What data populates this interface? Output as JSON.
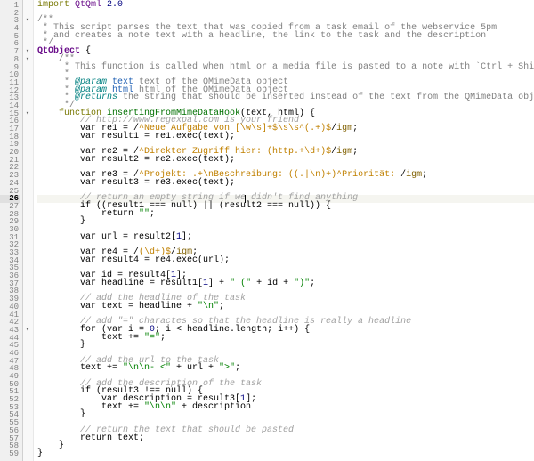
{
  "editor": {
    "current_line": 26,
    "fold_markers": [
      3,
      7,
      8,
      15,
      43
    ],
    "lines": [
      {
        "n": 1,
        "segs": [
          {
            "t": "import ",
            "c": "kw"
          },
          {
            "t": "QtQml ",
            "c": "type"
          },
          {
            "t": "2.0",
            "c": "num"
          }
        ]
      },
      {
        "n": 2,
        "segs": []
      },
      {
        "n": 3,
        "segs": [
          {
            "t": "/**",
            "c": "doc"
          }
        ]
      },
      {
        "n": 4,
        "segs": [
          {
            "t": " * This script parses the text that was copied from a task email of the webservice 5pm",
            "c": "doc"
          }
        ]
      },
      {
        "n": 5,
        "segs": [
          {
            "t": " * and creates a note text with a headline, the link to the task and the description",
            "c": "doc"
          }
        ]
      },
      {
        "n": 6,
        "segs": [
          {
            "t": " */",
            "c": "doc"
          }
        ]
      },
      {
        "n": 7,
        "segs": [
          {
            "t": "QtObject",
            "c": "obj"
          },
          {
            "t": " {",
            "c": "op"
          }
        ]
      },
      {
        "n": 8,
        "segs": [
          {
            "t": "    /**",
            "c": "doc"
          }
        ]
      },
      {
        "n": 9,
        "segs": [
          {
            "t": "     * This function is called when html or a media file is pasted to a note with `Ctrl + Shift + V`",
            "c": "doc"
          }
        ]
      },
      {
        "n": 10,
        "segs": [
          {
            "t": "     * ",
            "c": "doc"
          }
        ]
      },
      {
        "n": 11,
        "segs": [
          {
            "t": "     * ",
            "c": "doc"
          },
          {
            "t": "@param ",
            "c": "tag"
          },
          {
            "t": "text",
            "c": "pn"
          },
          {
            "t": " text of the QMimeData object",
            "c": "doc"
          }
        ]
      },
      {
        "n": 12,
        "segs": [
          {
            "t": "     * ",
            "c": "doc"
          },
          {
            "t": "@param ",
            "c": "tag"
          },
          {
            "t": "html",
            "c": "pn"
          },
          {
            "t": " html of the QMimeData object",
            "c": "doc"
          }
        ]
      },
      {
        "n": 13,
        "segs": [
          {
            "t": "     * ",
            "c": "doc"
          },
          {
            "t": "@returns",
            "c": "tag"
          },
          {
            "t": " the string that should be inserted instead of the text from the QMimeData object",
            "c": "doc"
          }
        ]
      },
      {
        "n": 14,
        "segs": [
          {
            "t": "     */",
            "c": "doc"
          }
        ]
      },
      {
        "n": 15,
        "segs": [
          {
            "t": "    function ",
            "c": "kw"
          },
          {
            "t": "insertingFromMimeDataHook",
            "c": "fn"
          },
          {
            "t": "(text, html) {",
            "c": "op"
          }
        ]
      },
      {
        "n": 16,
        "segs": [
          {
            "t": "        // http://www.regexpal.com is your friend",
            "c": "cmt"
          }
        ]
      },
      {
        "n": 17,
        "segs": [
          {
            "t": "        var re1 = /"
          },
          {
            "t": "^Neue Aufgabe von [\\w\\s]+$\\s\\s^(.+)$",
            "c": "regex"
          },
          {
            "t": "/"
          },
          {
            "t": "igm",
            "c": "flag"
          },
          {
            "t": ";"
          }
        ]
      },
      {
        "n": 18,
        "segs": [
          {
            "t": "        var result1 = re1.exec(text);"
          }
        ]
      },
      {
        "n": 19,
        "segs": []
      },
      {
        "n": 20,
        "segs": [
          {
            "t": "        var re2 = /"
          },
          {
            "t": "^Direkter Zugriff hier: (http.+\\d+)$",
            "c": "regex"
          },
          {
            "t": "/"
          },
          {
            "t": "igm",
            "c": "flag"
          },
          {
            "t": ";"
          }
        ]
      },
      {
        "n": 21,
        "segs": [
          {
            "t": "        var result2 = re2.exec(text);"
          }
        ]
      },
      {
        "n": 22,
        "segs": []
      },
      {
        "n": 23,
        "segs": [
          {
            "t": "        var re3 = /"
          },
          {
            "t": "^Projekt: .+\\nBeschreibung: ((.|\\n)+)^Priorität: ",
            "c": "regex"
          },
          {
            "t": "/"
          },
          {
            "t": "igm",
            "c": "flag"
          },
          {
            "t": ";"
          }
        ]
      },
      {
        "n": 24,
        "segs": [
          {
            "t": "        var result3 = re3.exec(text);"
          }
        ]
      },
      {
        "n": 25,
        "segs": []
      },
      {
        "n": 26,
        "hl": true,
        "segs": [
          {
            "t": "        // return an empty string if we",
            "c": "cmt"
          },
          {
            "t": "",
            "cursor": true
          },
          {
            "t": " didn't find anything",
            "c": "cmt"
          }
        ]
      },
      {
        "n": 27,
        "segs": [
          {
            "t": "        if ((result1 === null) || (result2 === null)) {"
          }
        ]
      },
      {
        "n": 28,
        "segs": [
          {
            "t": "            return "
          },
          {
            "t": "\"\"",
            "c": "str"
          },
          {
            "t": ";"
          }
        ]
      },
      {
        "n": 29,
        "segs": [
          {
            "t": "        }"
          }
        ]
      },
      {
        "n": 30,
        "segs": []
      },
      {
        "n": 31,
        "segs": [
          {
            "t": "        var url = result2["
          },
          {
            "t": "1",
            "c": "num"
          },
          {
            "t": "];"
          }
        ]
      },
      {
        "n": 32,
        "segs": []
      },
      {
        "n": 33,
        "segs": [
          {
            "t": "        var re4 = /"
          },
          {
            "t": "(\\d+)$",
            "c": "regex"
          },
          {
            "t": "/"
          },
          {
            "t": "igm",
            "c": "flag"
          },
          {
            "t": ";"
          }
        ]
      },
      {
        "n": 34,
        "segs": [
          {
            "t": "        var result4 = re4.exec(url);"
          }
        ]
      },
      {
        "n": 35,
        "segs": []
      },
      {
        "n": 36,
        "segs": [
          {
            "t": "        var id = result4["
          },
          {
            "t": "1",
            "c": "num"
          },
          {
            "t": "];"
          }
        ]
      },
      {
        "n": 37,
        "segs": [
          {
            "t": "        var headline = result1["
          },
          {
            "t": "1",
            "c": "num"
          },
          {
            "t": "] + "
          },
          {
            "t": "\" (\"",
            "c": "str"
          },
          {
            "t": " + id + "
          },
          {
            "t": "\")\"",
            "c": "str"
          },
          {
            "t": ";"
          }
        ]
      },
      {
        "n": 38,
        "segs": []
      },
      {
        "n": 39,
        "segs": [
          {
            "t": "        // add the headline of the task",
            "c": "cmt"
          }
        ]
      },
      {
        "n": 40,
        "segs": [
          {
            "t": "        var text = headline + "
          },
          {
            "t": "\"\\n\"",
            "c": "str"
          },
          {
            "t": ";"
          }
        ]
      },
      {
        "n": 41,
        "segs": []
      },
      {
        "n": 42,
        "segs": [
          {
            "t": "        // add \"=\" charactes so that the headline is really a headline",
            "c": "cmt"
          }
        ]
      },
      {
        "n": 43,
        "segs": [
          {
            "t": "        for (var i = "
          },
          {
            "t": "0",
            "c": "num"
          },
          {
            "t": "; i < headline.length; i++) {"
          }
        ]
      },
      {
        "n": 44,
        "segs": [
          {
            "t": "            text += "
          },
          {
            "t": "\"=\"",
            "c": "str"
          },
          {
            "t": ";"
          }
        ]
      },
      {
        "n": 45,
        "segs": [
          {
            "t": "        }"
          }
        ]
      },
      {
        "n": 46,
        "segs": []
      },
      {
        "n": 47,
        "segs": [
          {
            "t": "        // add the url to the task",
            "c": "cmt"
          }
        ]
      },
      {
        "n": 48,
        "segs": [
          {
            "t": "        text += "
          },
          {
            "t": "\"\\n\\n- <\"",
            "c": "str"
          },
          {
            "t": " + url + "
          },
          {
            "t": "\">\"",
            "c": "str"
          },
          {
            "t": ";"
          }
        ]
      },
      {
        "n": 49,
        "segs": []
      },
      {
        "n": 50,
        "segs": [
          {
            "t": "        // add the description of the task",
            "c": "cmt"
          }
        ]
      },
      {
        "n": 51,
        "segs": [
          {
            "t": "        if (result3 !== null) {"
          }
        ]
      },
      {
        "n": 52,
        "segs": [
          {
            "t": "            var description = result3["
          },
          {
            "t": "1",
            "c": "num"
          },
          {
            "t": "];"
          }
        ]
      },
      {
        "n": 53,
        "segs": [
          {
            "t": "            text += "
          },
          {
            "t": "\"\\n\\n\"",
            "c": "str"
          },
          {
            "t": " + description"
          }
        ]
      },
      {
        "n": 54,
        "segs": [
          {
            "t": "        }"
          }
        ]
      },
      {
        "n": 55,
        "segs": []
      },
      {
        "n": 56,
        "segs": [
          {
            "t": "        // return the text that should be pasted",
            "c": "cmt"
          }
        ]
      },
      {
        "n": 57,
        "segs": [
          {
            "t": "        return text;"
          }
        ]
      },
      {
        "n": 58,
        "segs": [
          {
            "t": "    }"
          }
        ]
      },
      {
        "n": 59,
        "segs": [
          {
            "t": "}"
          }
        ]
      }
    ]
  }
}
